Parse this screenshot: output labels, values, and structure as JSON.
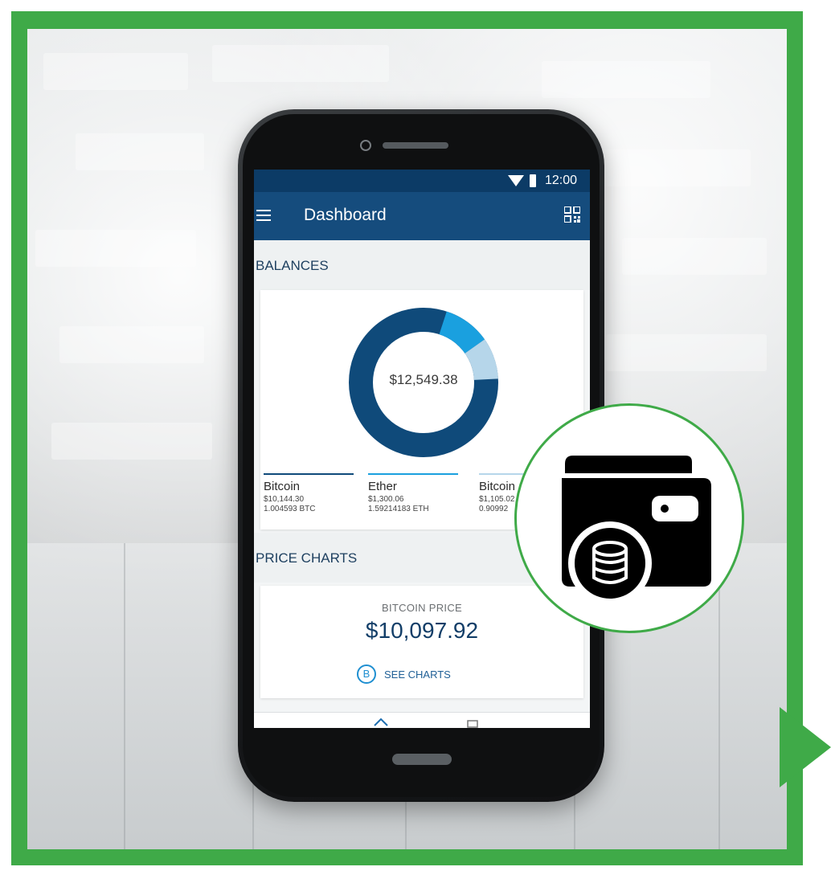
{
  "status_bar": {
    "time": "12:00"
  },
  "app_bar": {
    "title": "Dashboard"
  },
  "balances": {
    "header": "BALANCES",
    "total": "$12,549.38",
    "coins": [
      {
        "name": "Bitcoin",
        "usd": "$10,144.30",
        "amount": "1.004593 BTC",
        "color": "#0f4a7a"
      },
      {
        "name": "Ether",
        "usd": "$1,300.06",
        "amount": "1.59214183 ETH",
        "color": "#1aa0df"
      },
      {
        "name": "Bitcoin",
        "usd": "$1,105.02",
        "amount": "0.90992",
        "color": "#b6d6ea"
      }
    ]
  },
  "price_charts": {
    "header": "PRICE CHARTS",
    "label": "BITCOIN PRICE",
    "value": "$10,097.92",
    "button": "SEE CHARTS",
    "button_glyph": "B"
  },
  "colors": {
    "frame_green": "#3faa48",
    "app_bar": "#154c7d",
    "status_bar": "#0c3b66",
    "donut_primary": "#0f4a7a",
    "donut_secondary": "#1aa0df",
    "donut_tertiary": "#b6d6ea"
  },
  "icons": {
    "menu": "hamburger-menu-icon",
    "qr": "qr-code-icon",
    "badge": "wallet-with-coins-icon",
    "wifi": "wifi-icon",
    "battery": "battery-icon",
    "bitcoin": "bitcoin-icon"
  }
}
